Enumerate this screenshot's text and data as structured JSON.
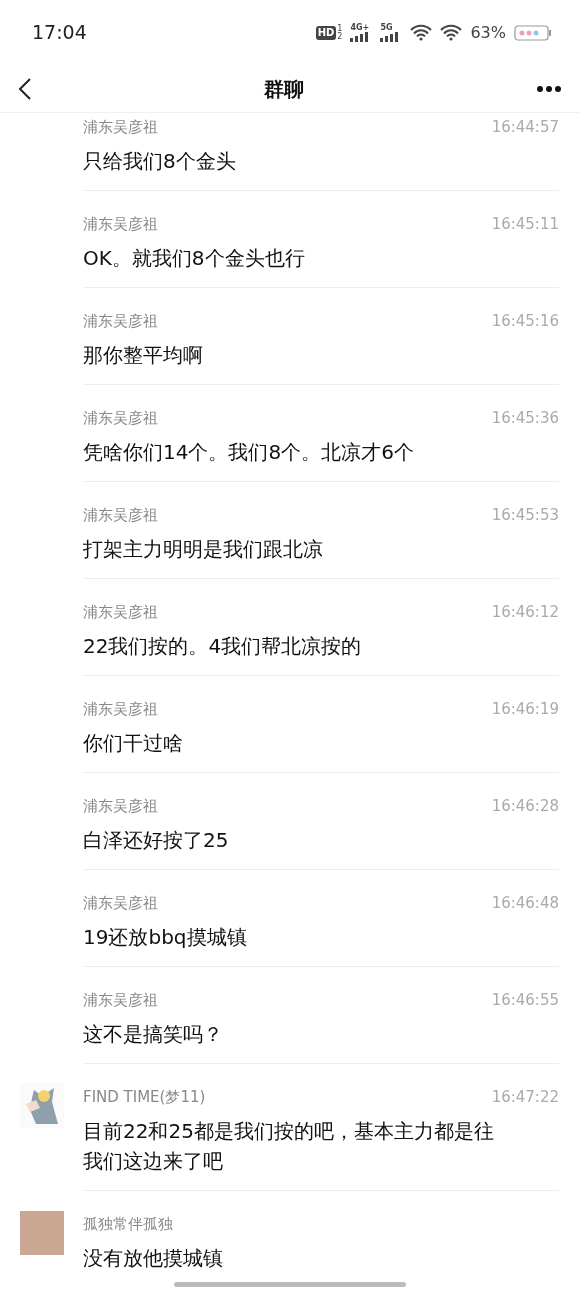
{
  "status_bar": {
    "time": "17:04",
    "hd_label": "HD",
    "sim_index": "1",
    "sim_sub": "2",
    "net_1": "4G+",
    "net_2": "5G",
    "battery_percent": "63%"
  },
  "header": {
    "title": "群聊"
  },
  "messages": [
    {
      "kind": "plain",
      "sender": "浦东吴彦祖",
      "time": "16:44:57",
      "text": "只给我们8个金头"
    },
    {
      "kind": "plain",
      "sender": "浦东吴彦祖",
      "time": "16:45:11",
      "text": "OK。就我们8个金头也行"
    },
    {
      "kind": "plain",
      "sender": "浦东吴彦祖",
      "time": "16:45:16",
      "text": "那你整平均啊"
    },
    {
      "kind": "plain",
      "sender": "浦东吴彦祖",
      "time": "16:45:36",
      "text": "凭啥你们14个。我们8个。北凉才6个"
    },
    {
      "kind": "plain",
      "sender": "浦东吴彦祖",
      "time": "16:45:53",
      "text": "打架主力明明是我们跟北凉"
    },
    {
      "kind": "plain",
      "sender": "浦东吴彦祖",
      "time": "16:46:12",
      "text": "22我们按的。4我们帮北凉按的"
    },
    {
      "kind": "plain",
      "sender": "浦东吴彦祖",
      "time": "16:46:19",
      "text": "你们干过啥"
    },
    {
      "kind": "plain",
      "sender": "浦东吴彦祖",
      "time": "16:46:28",
      "text": "白泽还好按了25"
    },
    {
      "kind": "plain",
      "sender": "浦东吴彦祖",
      "time": "16:46:48",
      "text": "19还放bbq摸城镇"
    },
    {
      "kind": "plain",
      "sender": "浦东吴彦祖",
      "time": "16:46:55",
      "text": "这不是搞笑吗？"
    },
    {
      "kind": "cartoon",
      "sender": "FIND TIME(梦11)",
      "time": "16:47:22",
      "text": "目前22和25都是我们按的吧，基本主力都是往我们这边来了吧"
    },
    {
      "kind": "photo",
      "sender": "孤独常伴孤独",
      "text": "没有放他摸城镇"
    }
  ]
}
